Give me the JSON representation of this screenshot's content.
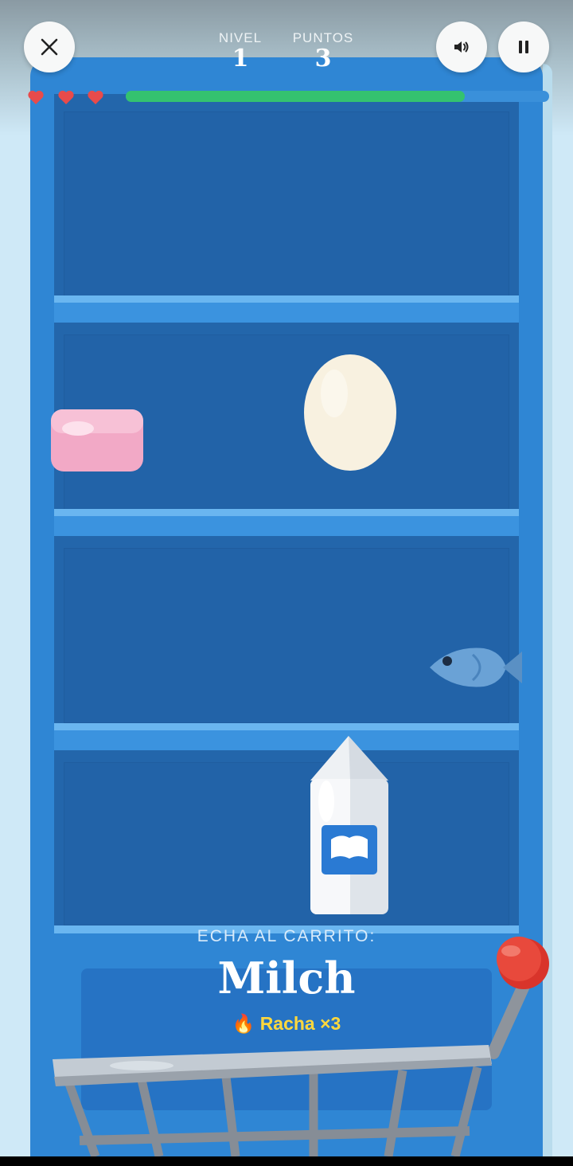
{
  "hud": {
    "level_label": "NIVEL",
    "level_value": "1",
    "points_label": "PUNTOS",
    "points_value": "3",
    "lives": 3,
    "progress": 0.8
  },
  "icons": {
    "close": "close-icon",
    "sound": "speaker-icon",
    "pause": "pause-icon",
    "life": "heart-icon",
    "streak": "fire-icon"
  },
  "prompt": {
    "label": "ECHA AL CARRITO:",
    "word": "Milch",
    "streak_text": "Racha ×3"
  },
  "items": [
    "soap",
    "egg",
    "fish",
    "milk-carton"
  ],
  "colors": {
    "cabinet": "#2f86d4",
    "shelf": "#2366ab",
    "progress": "#34c26f",
    "heart": "#e84b4b",
    "streak": "#ffd83d"
  }
}
